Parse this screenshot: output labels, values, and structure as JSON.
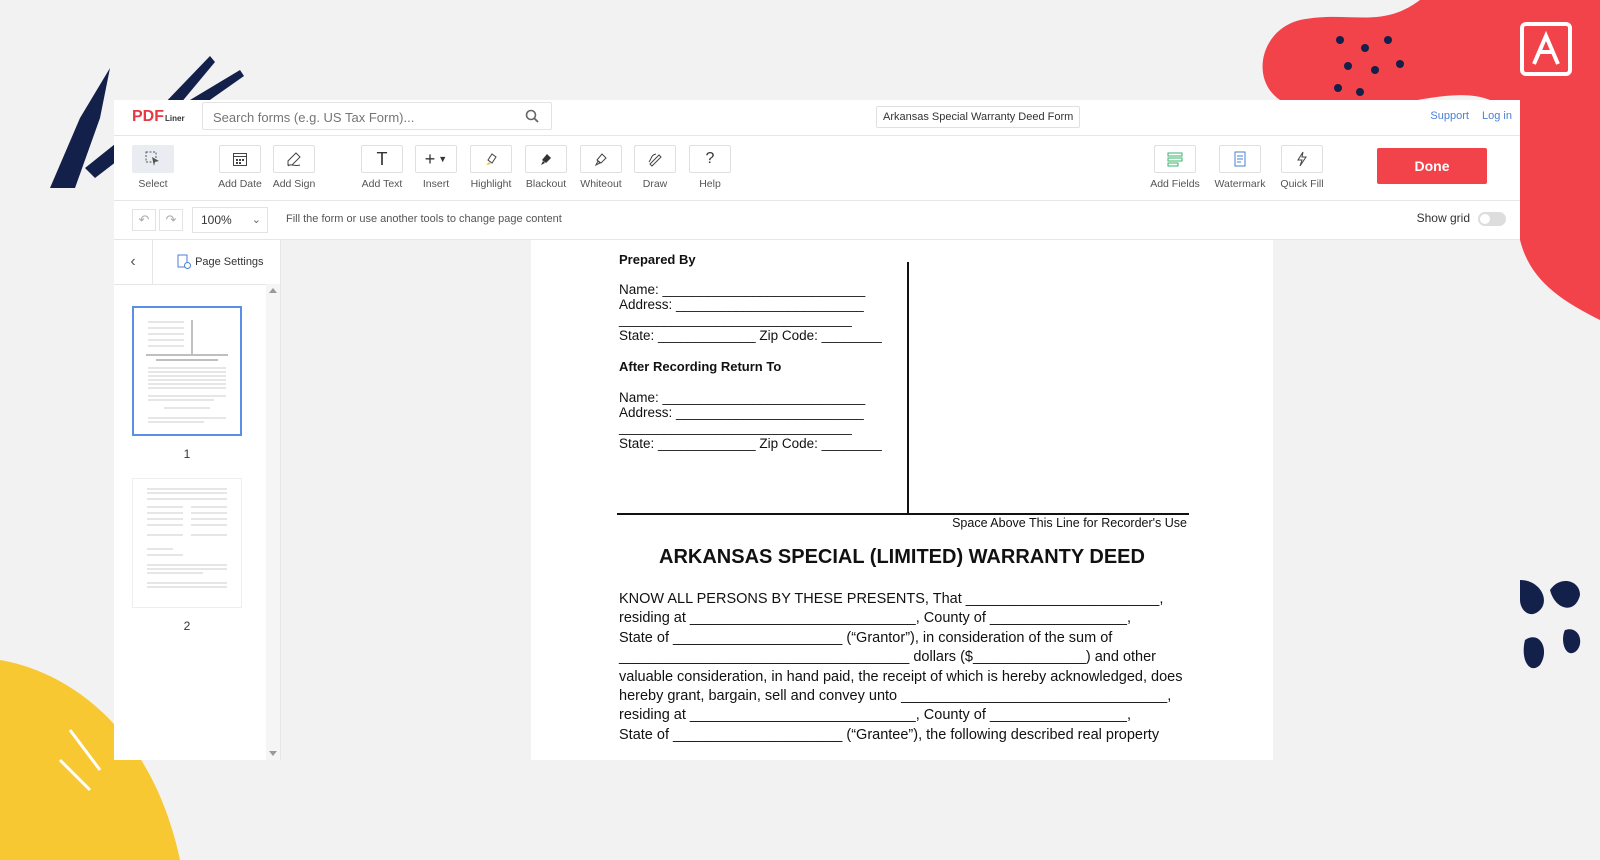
{
  "app": {
    "logo_main": "PDF",
    "logo_sub": "Liner",
    "search_placeholder": "Search forms (e.g. US Tax Form)...",
    "doc_title": "Arkansas Special Warranty Deed Form",
    "support_label": "Support",
    "login_label": "Log in"
  },
  "toolbar": {
    "select": "Select",
    "add_date": "Add Date",
    "add_sign": "Add Sign",
    "add_text": "Add Text",
    "insert": "Insert",
    "highlight": "Highlight",
    "blackout": "Blackout",
    "whiteout": "Whiteout",
    "draw": "Draw",
    "help": "Help",
    "add_fields": "Add Fields",
    "watermark": "Watermark",
    "quick_fill": "Quick Fill",
    "done": "Done"
  },
  "subbar": {
    "zoom": "100%",
    "hint": "Fill the form or use another tools to change page content",
    "show_grid": "Show grid"
  },
  "sidebar": {
    "page_settings": "Page Settings",
    "pages": [
      "1",
      "2"
    ]
  },
  "document": {
    "prepared_by": "Prepared By",
    "name1": "Name: ___________________________",
    "address1": "Address: _________________________",
    "line1": "_______________________________",
    "state1": "State: _____________ Zip Code: ________",
    "after_recording": "After Recording Return To",
    "name2": "Name: ___________________________",
    "address2": "Address: _________________________",
    "line2": "_______________________________",
    "state2": "State: _____________ Zip Code: ________",
    "recorder_note": "Space Above This Line for Recorder's Use",
    "title": "ARKANSAS SPECIAL (LIMITED) WARRANTY DEED",
    "body_lines": [
      "KNOW ALL PERSONS BY THESE PRESENTS, That ________________________,",
      "residing at ____________________________, County of _________________,",
      "State of _____________________ (“Grantor”), in consideration of the sum of",
      "____________________________________ dollars ($______________) and other",
      "valuable consideration, in hand paid, the receipt of which is hereby acknowledged, does",
      "hereby grant, bargain, sell and convey unto _________________________________,",
      "residing at ____________________________, County of _________________,",
      "State of _____________________ (“Grantee”), the following described real property"
    ]
  },
  "colors": {
    "accent_red": "#f2424a",
    "link_blue": "#4a7fd6",
    "deco_yellow": "#f7c831",
    "deco_navy": "#13204a"
  }
}
